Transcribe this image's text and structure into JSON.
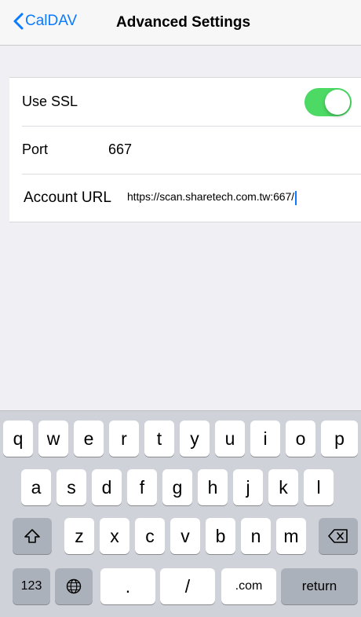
{
  "navbar": {
    "back_label": "CalDAV",
    "title": "Advanced Settings"
  },
  "settings": {
    "use_ssl_label": "Use SSL",
    "use_ssl_enabled": true,
    "port_label": "Port",
    "port_value": "667",
    "account_url_label": "Account URL",
    "account_url_value": "https://scan.sharetech.com.tw:667/"
  },
  "keyboard": {
    "row1": [
      "q",
      "w",
      "e",
      "r",
      "t",
      "y",
      "u",
      "i",
      "o",
      "p"
    ],
    "row2": [
      "a",
      "s",
      "d",
      "f",
      "g",
      "h",
      "j",
      "k",
      "l"
    ],
    "row3": [
      "z",
      "x",
      "c",
      "v",
      "b",
      "n",
      "m"
    ],
    "numbers_key": "123",
    "dot_key": ".",
    "slash_key": "/",
    "dotcom_key": ".com",
    "return_key": "return",
    "icons": {
      "shift": "shift-icon",
      "delete": "backspace-icon",
      "globe": "globe-icon"
    }
  },
  "colors": {
    "accent": "#0a7aff",
    "toggle_on": "#4cd964"
  }
}
